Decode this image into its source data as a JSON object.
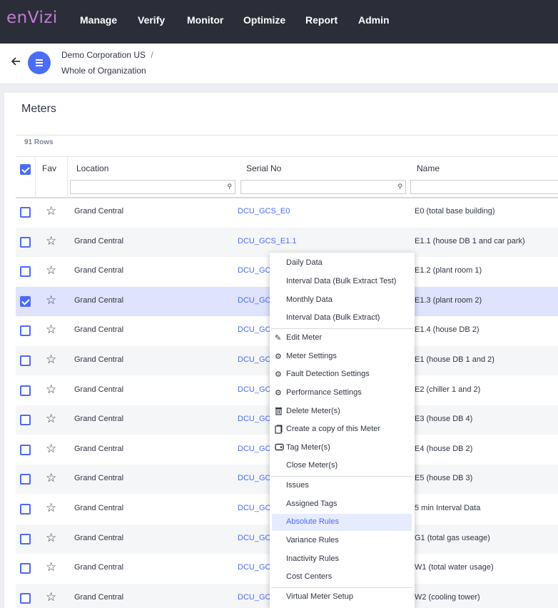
{
  "brand": {
    "logo": "enVizi"
  },
  "nav": [
    "Manage",
    "Verify",
    "Monitor",
    "Optimize",
    "Report",
    "Admin"
  ],
  "breadcrumb": {
    "level1": "Demo Corporation US",
    "separator": "/",
    "level2": "Whole of Organization"
  },
  "page": {
    "title": "Meters",
    "row_count": "91 Rows"
  },
  "table": {
    "headers": {
      "fav": "Fav",
      "location": "Location",
      "serial": "Serial No",
      "name": "Name"
    },
    "rows": [
      {
        "location": "Grand Central",
        "serial": "DCU_GCS_E0",
        "name": "E0 (total base building)",
        "checked": false
      },
      {
        "location": "Grand Central",
        "serial": "DCU_GCS_E1.1",
        "name": "E1.1 (house DB 1 and car park)",
        "checked": false
      },
      {
        "location": "Grand Central",
        "serial": "DCU_GC",
        "name": "E1.2 (plant room 1)",
        "checked": false
      },
      {
        "location": "Grand Central",
        "serial": "DCU_GC",
        "name": "E1.3 (plant room 2)",
        "checked": true
      },
      {
        "location": "Grand Central",
        "serial": "DCU_GC",
        "name": "E1.4 (house DB 2)",
        "checked": false
      },
      {
        "location": "Grand Central",
        "serial": "DCU_GC",
        "name": "E1 (house DB 1 and 2)",
        "checked": false
      },
      {
        "location": "Grand Central",
        "serial": "DCU_GC",
        "name": "E2 (chiller 1 and 2)",
        "checked": false
      },
      {
        "location": "Grand Central",
        "serial": "DCU_GC",
        "name": "E3 (house DB 4)",
        "checked": false
      },
      {
        "location": "Grand Central",
        "serial": "DCU_GC",
        "name": "E4 (house DB 2)",
        "checked": false
      },
      {
        "location": "Grand Central",
        "serial": "DCU_GC",
        "name": "E5 (house DB 3)",
        "checked": false
      },
      {
        "location": "Grand Central",
        "serial": "DCU_GC",
        "name": "5 min Interval Data",
        "checked": false
      },
      {
        "location": "Grand Central",
        "serial": "DCU_GC",
        "name": "G1 (total gas useage)",
        "checked": false
      },
      {
        "location": "Grand Central",
        "serial": "DCU_GC",
        "name": "W1 (total water usage)",
        "checked": false
      },
      {
        "location": "Grand Central",
        "serial": "DCU_GC",
        "name": "W2 (cooling tower)",
        "checked": false
      }
    ]
  },
  "context_menu": {
    "items": [
      "Daily Data",
      "Interval Data (Bulk Extract Test)",
      "Monthly Data",
      "Interval Data (Bulk Extract)",
      "Edit Meter",
      "Meter Settings",
      "Fault Detection Settings",
      "Performance Settings",
      "Delete Meter(s)",
      "Create a copy of this Meter",
      "Tag Meter(s)",
      "Close Meter(s)",
      "Issues",
      "Assigned Tags",
      "Absolute Rules",
      "Variance Rules",
      "Inactivity Rules",
      "Cost Centers",
      "Virtual Meter Setup"
    ],
    "highlighted": "Absolute Rules"
  },
  "colors": {
    "accent": "#4a6cf7",
    "nav_bg": "#2b2e38",
    "logo": "#c27bd6"
  }
}
